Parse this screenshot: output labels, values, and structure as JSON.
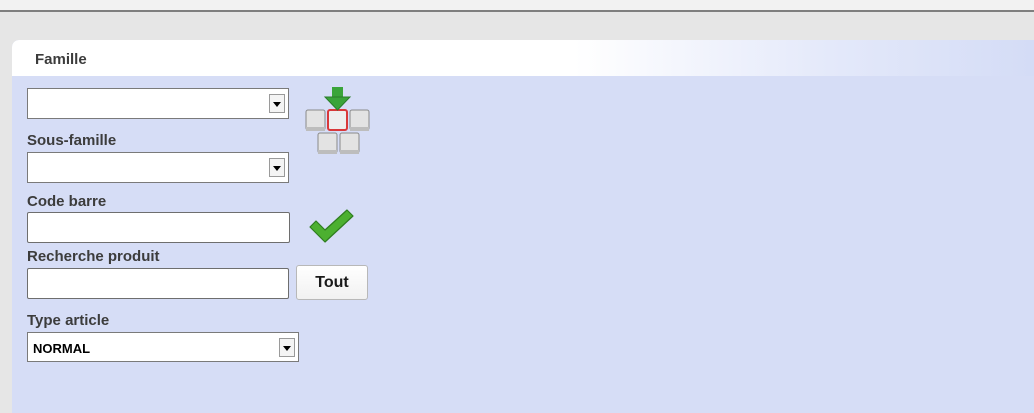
{
  "panel": {
    "title": "Famille"
  },
  "fields": {
    "famille_select": {
      "value": ""
    },
    "sous_famille": {
      "label": "Sous-famille",
      "value": ""
    },
    "code_barre": {
      "label": "Code barre",
      "value": ""
    },
    "recherche_produit": {
      "label": "Recherche produit",
      "value": "",
      "button_label": "Tout"
    },
    "type_article": {
      "label": "Type article",
      "value": "NORMAL"
    }
  },
  "icons": {
    "keyboard": "virtual-keyboard-icon",
    "check": "checkmark-icon"
  },
  "colors": {
    "panel_bg": "#d6ddf6",
    "check_green": "#4cb030",
    "arrow_green": "#3aa43a",
    "key_highlight": "#d9383a"
  }
}
